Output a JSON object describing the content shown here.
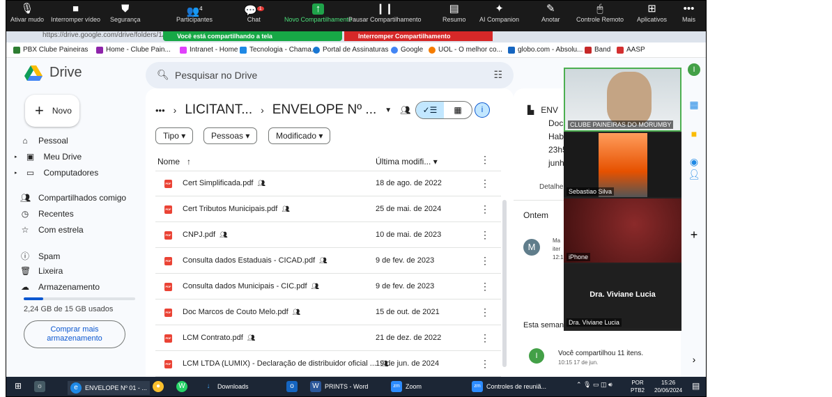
{
  "zoom": {
    "items": [
      {
        "label": "Ativar mudo",
        "icon": "🎙"
      },
      {
        "label": "Interromper vídeo",
        "icon": "■"
      },
      {
        "label": "Segurança",
        "icon": "⛊"
      },
      {
        "label": "Participantes",
        "icon": "👥",
        "count": "4"
      },
      {
        "label": "Chat",
        "icon": "💬",
        "badge": "1"
      },
      {
        "label": "Novo Compartilhamento",
        "icon": "↑"
      },
      {
        "label": "Pausar Compartilhamento",
        "icon": "❙❙"
      },
      {
        "label": "Resumo",
        "icon": "▤"
      },
      {
        "label": "AI Companion",
        "icon": "✦"
      },
      {
        "label": "Anotar",
        "icon": "✎"
      },
      {
        "label": "Controle Remoto",
        "icon": "🖱"
      },
      {
        "label": "Aplicativos",
        "icon": "⊞"
      },
      {
        "label": "Mais",
        "icon": "•••"
      }
    ],
    "sharing_banner": "Você está compartilhando a tela",
    "stop_share": "Interromper Compartilhamento"
  },
  "browser": {
    "url": "https://drive.google.com/drive/folders/1AS",
    "bookmarks": [
      {
        "label": "PBX Clube Paineiras",
        "color": "#2e7d32"
      },
      {
        "label": "Home - Clube Pain...",
        "color": "#8e24aa"
      },
      {
        "label": "Intranet - Home",
        "color": "#e040fb"
      },
      {
        "label": "Tecnologia - Chama...",
        "color": "#1e88e5"
      },
      {
        "label": "Portal de Assinaturas",
        "color": "#1976d2"
      },
      {
        "label": "Google",
        "color": "#4285f4"
      },
      {
        "label": "UOL - O melhor co...",
        "color": "#f57c00"
      },
      {
        "label": "globo.com - Absolu...",
        "color": "#1565c0"
      },
      {
        "label": "Band",
        "color": "#c62828"
      },
      {
        "label": "AASP",
        "color": "#d32f2f"
      }
    ]
  },
  "drive": {
    "app": "Drive",
    "search_placeholder": "Pesquisar no Drive",
    "new": "Novo",
    "nav": [
      "Pessoal",
      "Meu Drive",
      "Computadores",
      "Compartilhados comigo",
      "Recentes",
      "Com estrela",
      "Spam",
      "Lixeira",
      "Armazenamento"
    ],
    "storage": "2,24 GB de 15 GB usados",
    "buy_more": "Comprar mais armazenamento",
    "breadcrumb": [
      "LICITANT...",
      "ENVELOPE Nº ..."
    ],
    "filters": [
      "Tipo",
      "Pessoas",
      "Modificado"
    ],
    "col_name": "Nome",
    "col_modified": "Última modifi...",
    "files": [
      {
        "name": "Cert Simplificada.pdf",
        "date": "18 de ago. de 2022"
      },
      {
        "name": "Cert Tributos Municipais.pdf",
        "date": "25 de mai. de 2024"
      },
      {
        "name": "CNPJ.pdf",
        "date": "10 de mai. de 2023"
      },
      {
        "name": "Consulta dados Estaduais - CICAD.pdf",
        "date": "9 de fev. de 2023"
      },
      {
        "name": "Consulta dados Municipais - CIC.pdf",
        "date": "9 de fev. de 2023"
      },
      {
        "name": "Doc Marcos de Couto Melo.pdf",
        "date": "15 de out. de 2021"
      },
      {
        "name": "LCM Contrato.pdf",
        "date": "21 de dez. de 2022"
      },
      {
        "name": "LCM LTDA (LUMIX) - Declaração de distribuidor oficial ...",
        "date": "19 de jun. de 2024"
      }
    ],
    "details": {
      "title_part": "ENV",
      "lines": [
        "Doc",
        "Habi",
        "23h5",
        "junh"
      ],
      "tab": "Detalhe",
      "today": "Ontem",
      "avatar": "M",
      "act_lines": [
        "Ma",
        "iter",
        "12:1"
      ],
      "week": "Esta seman",
      "shared": "Você compartilhou 11 itens.",
      "shared_time": "10:15 17 de jun.",
      "user_avatar": "I"
    }
  },
  "video": {
    "tiles": [
      "CLUBE PAINEIRAS DO MORUMBY",
      "Sebastiao Silva",
      "iPhone",
      "Dra. Viviane Lucia"
    ],
    "name_big": "Dra. Viviane Lucia"
  },
  "taskbar": {
    "items": [
      {
        "label": "ENVELOPE Nº 01 - ...",
        "icon": "e",
        "color": "#1e88e5"
      },
      {
        "label": "",
        "icon": "●",
        "color": "#fbc02d"
      },
      {
        "label": "",
        "icon": "W",
        "color": "#25d366"
      },
      {
        "label": "Downloads",
        "icon": "↓",
        "color": "#1e88e5"
      },
      {
        "label": "",
        "icon": "o",
        "color": "#1565c0"
      },
      {
        "label": "PRINTS - Word",
        "icon": "W",
        "color": "#2b579a"
      },
      {
        "label": "Zoom",
        "icon": "zm",
        "color": "#2d8cff"
      },
      {
        "label": "Controles de reuniã...",
        "icon": "zm",
        "color": "#2d8cff"
      }
    ],
    "lang": "POR",
    "lang2": "PTB2",
    "time": "15:26",
    "date": "20/06/2024"
  }
}
